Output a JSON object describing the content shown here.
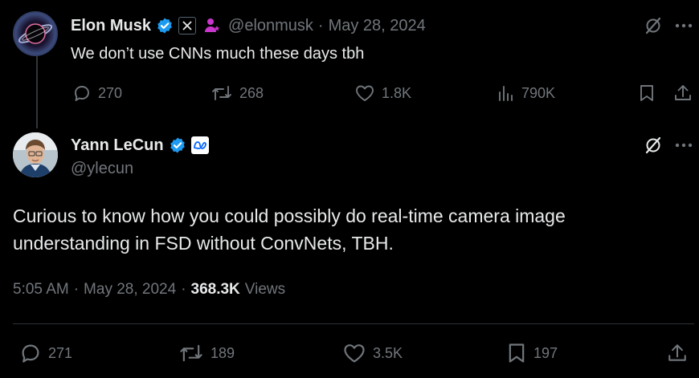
{
  "parent_tweet": {
    "author_name": "Elon Musk",
    "handle": "@elonmusk",
    "separator": "·",
    "date": "May 28, 2024",
    "text": "We don’t use CNNs much these days tbh",
    "stats": {
      "replies": "270",
      "reposts": "268",
      "likes": "1.8K",
      "views": "790K"
    },
    "colors": {
      "verified": "#1d9bf0",
      "affiliate": "#c936cc"
    },
    "icons": [
      "verified-badge-icon",
      "x-logo-icon",
      "affiliate-person-icon",
      "grok-icon",
      "more-icon",
      "reply-icon",
      "repost-icon",
      "like-icon",
      "views-icon",
      "bookmark-icon",
      "share-icon"
    ]
  },
  "main_tweet": {
    "author_name": "Yann LeCun",
    "handle": "@ylecun",
    "text": "Curious to know how you could possibly do real-time camera image understanding in FSD without ConvNets, TBH.",
    "time": "5:05 AM",
    "separator": "·",
    "date": "May 28, 2024",
    "separator2": "·",
    "views_count": "368.3K",
    "views_label": "Views",
    "stats": {
      "replies": "271",
      "reposts": "189",
      "likes": "3.5K",
      "bookmarks": "197"
    },
    "colors": {
      "verified": "#1d9bf0",
      "meta_badge": "#0866ff"
    },
    "icons": [
      "verified-badge-icon",
      "meta-logo-icon",
      "grok-icon",
      "more-icon",
      "reply-icon",
      "repost-icon",
      "like-icon",
      "bookmark-icon",
      "share-icon"
    ]
  }
}
